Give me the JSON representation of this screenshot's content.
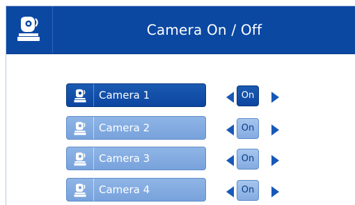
{
  "header": {
    "title": "Camera On / Off",
    "icon": "camera-icon"
  },
  "cameras": [
    {
      "label": "Camera 1",
      "state": "On",
      "selected": true
    },
    {
      "label": "Camera 2",
      "state": "On",
      "selected": false
    },
    {
      "label": "Camera 3",
      "state": "On",
      "selected": false
    },
    {
      "label": "Camera 4",
      "state": "On",
      "selected": false
    }
  ],
  "colors": {
    "header_bg": "#0b48a2",
    "selected_bg": "#0c45a0",
    "unselected_bg": "#78a2dc",
    "arrow": "#1758b8"
  }
}
